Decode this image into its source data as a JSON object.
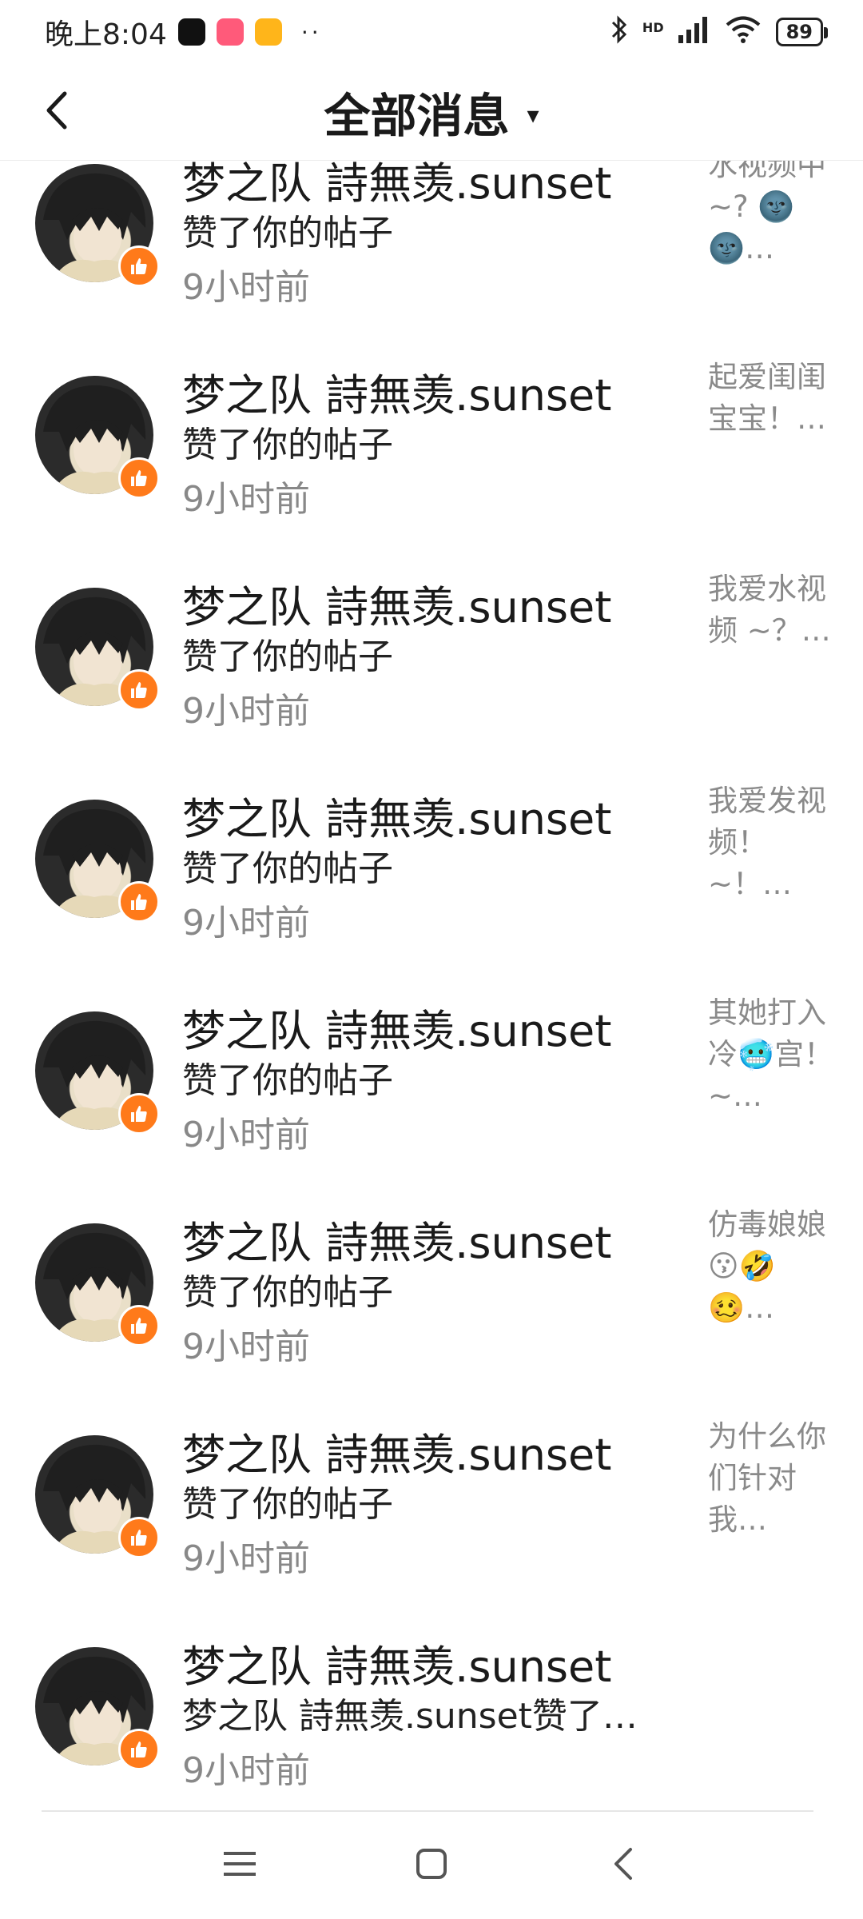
{
  "status_bar": {
    "time": "晚上8:04",
    "dots": "··",
    "network": "HD",
    "battery": "89"
  },
  "header": {
    "title": "全部消息",
    "dropdown_caret": "▾"
  },
  "messages": [
    {
      "name": "梦之队  詩無羡.sunset",
      "action": "赞了你的帖子",
      "time": "9小时前",
      "preview": "水视频中~? 🌚🌚…"
    },
    {
      "name": "梦之队  詩無羡.sunset",
      "action": "赞了你的帖子",
      "time": "9小时前",
      "preview": "起爱闺闺宝宝！…"
    },
    {
      "name": "梦之队  詩無羡.sunset",
      "action": "赞了你的帖子",
      "time": "9小时前",
      "preview": "我爱水视频 ~？…"
    },
    {
      "name": "梦之队  詩無羡.sunset",
      "action": "赞了你的帖子",
      "time": "9小时前",
      "preview": "我爱发视频！ ~！…"
    },
    {
      "name": "梦之队  詩無羡.sunset",
      "action": "赞了你的帖子",
      "time": "9小时前",
      "preview": "其她打入冷🥶宫！ ~…"
    },
    {
      "name": "梦之队  詩無羡.sunset",
      "action": "赞了你的帖子",
      "time": "9小时前",
      "preview": "仿毒娘娘😗🤣🥴…"
    },
    {
      "name": "梦之队  詩無羡.sunset",
      "action": "赞了你的帖子",
      "time": "9小时前",
      "preview": "为什么你们针对我…"
    },
    {
      "name": "梦之队  詩無羡.sunset",
      "action": "梦之队  詩無羡.sunset赞了…",
      "time": "9小时前",
      "preview": ""
    }
  ],
  "colors": {
    "like_badge": "#ff7a1a",
    "time_text": "#888888"
  },
  "icons": {
    "back": "chevron-left-icon",
    "like": "thumbs-up-icon",
    "nav_menu": "menu-icon",
    "nav_home": "home-square-icon",
    "nav_back": "back-triangle-icon"
  }
}
